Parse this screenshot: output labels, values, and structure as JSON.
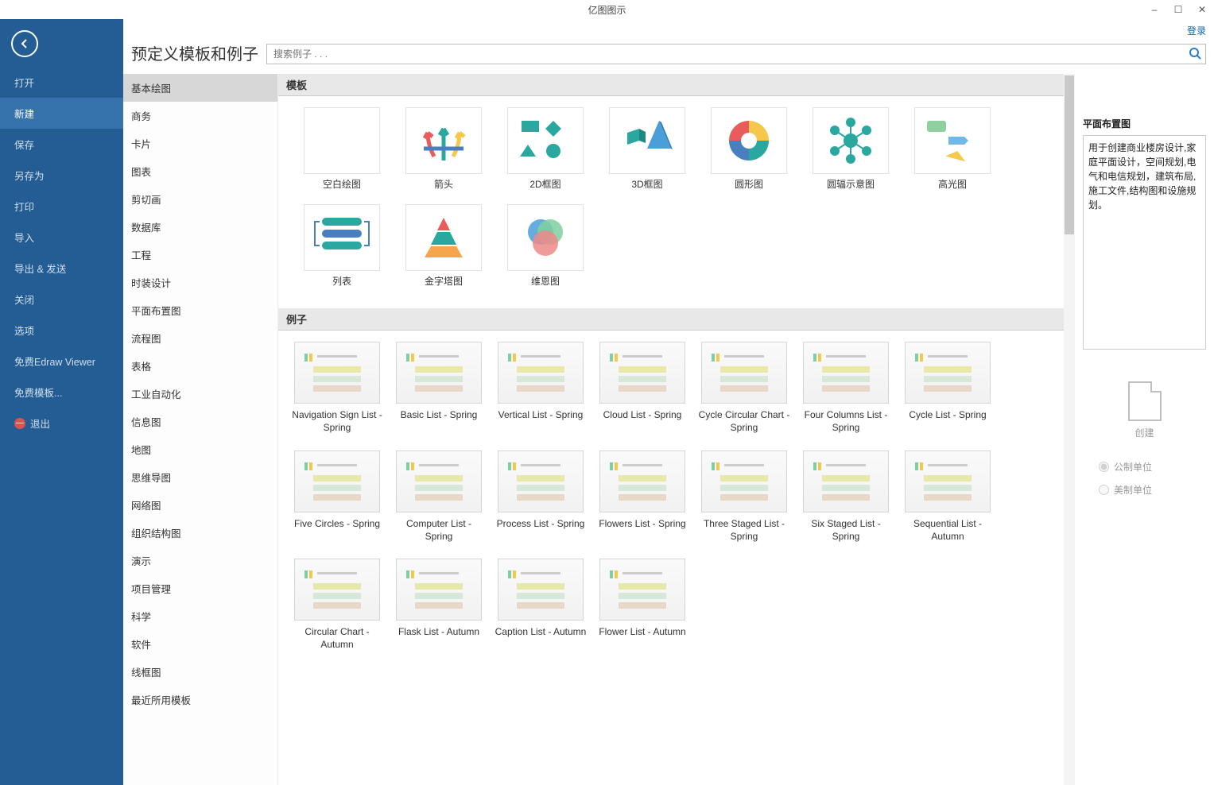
{
  "app_title": "亿图图示",
  "login_label": "登录",
  "window_controls": {
    "min": "–",
    "max": "☐",
    "close": "✕"
  },
  "back_icon": "←",
  "nav": [
    {
      "label": "打开",
      "key": "open"
    },
    {
      "label": "新建",
      "key": "new",
      "active": true
    },
    {
      "label": "保存",
      "key": "save"
    },
    {
      "label": "另存为",
      "key": "saveas"
    },
    {
      "label": "打印",
      "key": "print"
    },
    {
      "label": "导入",
      "key": "import"
    },
    {
      "label": "导出 & 发送",
      "key": "export"
    },
    {
      "label": "关闭",
      "key": "close"
    },
    {
      "label": "选项",
      "key": "options"
    },
    {
      "label": "免费Edraw Viewer",
      "key": "viewer"
    },
    {
      "label": "免费模板...",
      "key": "freetpl"
    },
    {
      "label": "退出",
      "key": "exit",
      "exit": true
    }
  ],
  "page_title": "预定义模板和例子",
  "search_placeholder": "搜索例子 . . .",
  "categories": [
    {
      "label": "基本绘图",
      "active": true
    },
    {
      "label": "商务"
    },
    {
      "label": "卡片"
    },
    {
      "label": "图表"
    },
    {
      "label": "剪切画"
    },
    {
      "label": "数据库"
    },
    {
      "label": "工程"
    },
    {
      "label": "时装设计"
    },
    {
      "label": "平面布置图"
    },
    {
      "label": "流程图"
    },
    {
      "label": "表格"
    },
    {
      "label": "工业自动化"
    },
    {
      "label": "信息图"
    },
    {
      "label": "地图"
    },
    {
      "label": "思维导图"
    },
    {
      "label": "网络图"
    },
    {
      "label": "组织结构图"
    },
    {
      "label": "演示"
    },
    {
      "label": "项目管理"
    },
    {
      "label": "科学"
    },
    {
      "label": "软件"
    },
    {
      "label": "线框图"
    },
    {
      "label": "最近所用模板"
    }
  ],
  "sections": {
    "templates": "模板",
    "examples": "例子"
  },
  "templates": [
    {
      "label": "空白绘图",
      "key": "blank"
    },
    {
      "label": "箭头",
      "key": "arrows"
    },
    {
      "label": "2D框图",
      "key": "2dblock"
    },
    {
      "label": "3D框图",
      "key": "3dblock"
    },
    {
      "label": "圆形图",
      "key": "circle"
    },
    {
      "label": "圆辐示意图",
      "key": "spoke"
    },
    {
      "label": "高光图",
      "key": "highlight"
    },
    {
      "label": "列表",
      "key": "list"
    },
    {
      "label": "金字塔图",
      "key": "pyramid"
    },
    {
      "label": "维恩图",
      "key": "venn"
    }
  ],
  "examples": [
    {
      "label": "Navigation Sign List - Spring"
    },
    {
      "label": "Basic List - Spring"
    },
    {
      "label": "Vertical List - Spring"
    },
    {
      "label": "Cloud List - Spring"
    },
    {
      "label": "Cycle Circular Chart - Spring"
    },
    {
      "label": "Four Columns List - Spring"
    },
    {
      "label": "Cycle List - Spring"
    },
    {
      "label": "Five Circles - Spring"
    },
    {
      "label": "Computer List - Spring"
    },
    {
      "label": "Process List - Spring"
    },
    {
      "label": "Flowers List - Spring"
    },
    {
      "label": "Three Staged List - Spring"
    },
    {
      "label": "Six Staged List - Spring"
    },
    {
      "label": "Sequential List - Autumn"
    },
    {
      "label": "Circular Chart - Autumn"
    },
    {
      "label": "Flask List - Autumn"
    },
    {
      "label": "Caption List - Autumn"
    },
    {
      "label": "Flower List - Autumn"
    }
  ],
  "right": {
    "title": "平面布置图",
    "description": "用于创建商业楼房设计,家庭平面设计，空间规划,电气和电信规划，建筑布局,施工文件,结构图和设施规划。",
    "create_label": "创建",
    "unit_metric": "公制单位",
    "unit_imperial": "美制单位"
  }
}
